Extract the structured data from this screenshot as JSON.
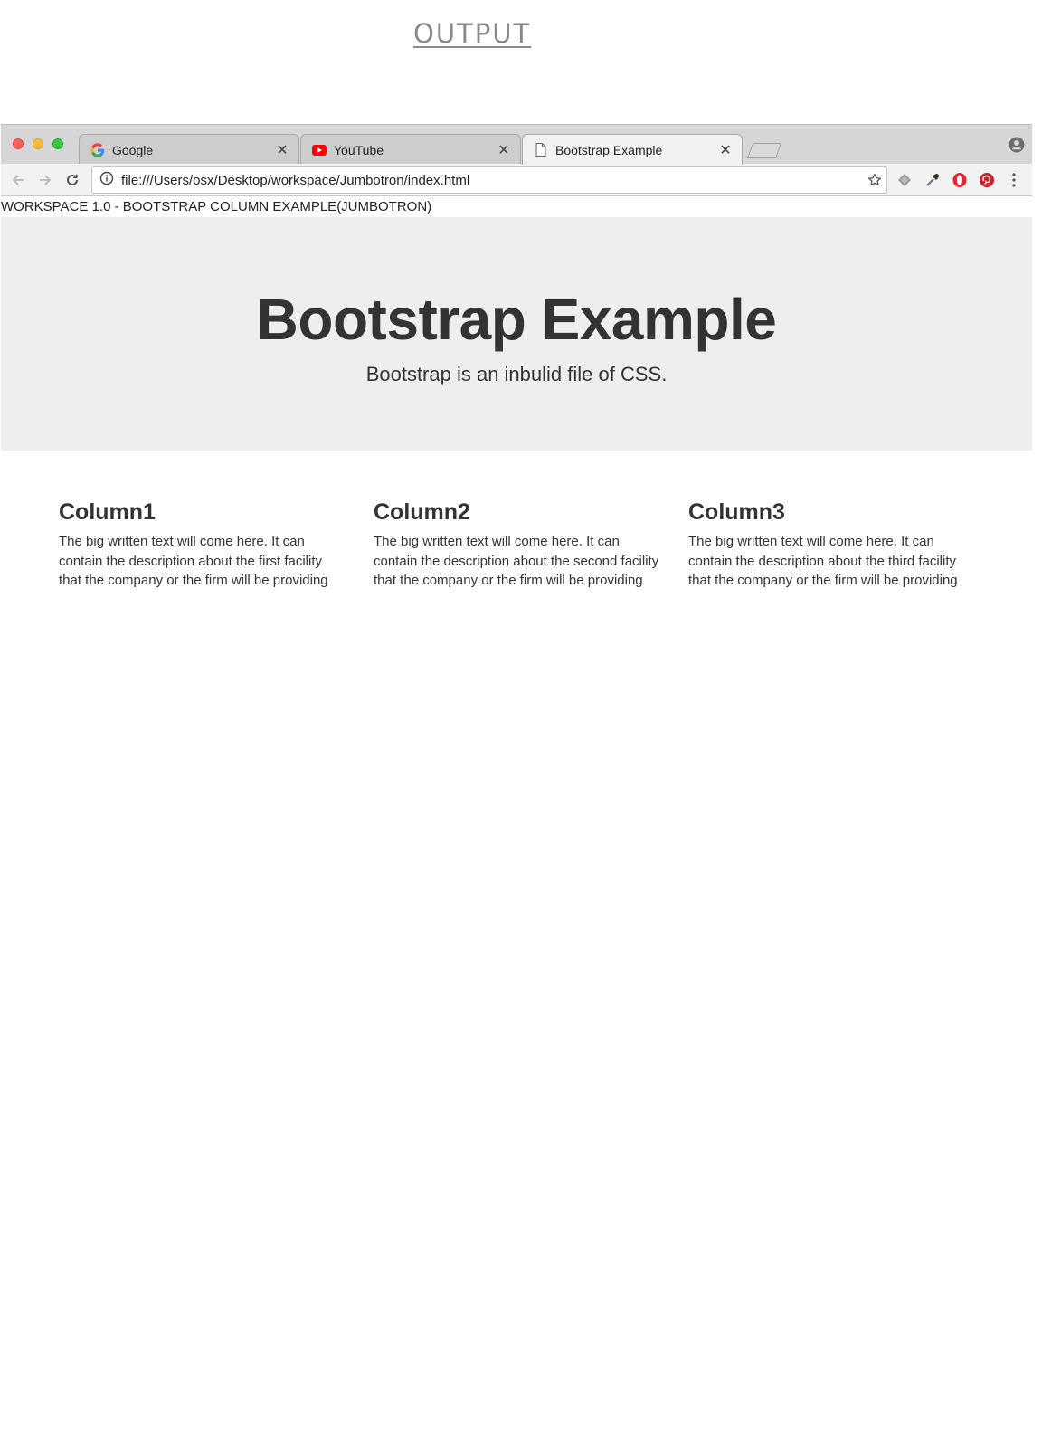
{
  "output_heading": "OUTPUT",
  "browser": {
    "tabs": [
      {
        "label": "Google",
        "icon": "google-icon",
        "active": false
      },
      {
        "label": "YouTube",
        "icon": "youtube-icon",
        "active": false
      },
      {
        "label": "Bootstrap Example",
        "icon": "page-icon",
        "active": true
      }
    ],
    "address": "file:///Users/osx/Desktop/workspace/Jumbotron/index.html"
  },
  "page": {
    "caption": "WORKSPACE 1.0 - BOOTSTRAP COLUMN EXAMPLE(JUMBOTRON)",
    "jumbotron": {
      "title": "Bootstrap Example",
      "subtitle": "Bootstrap is an inbulid file of CSS."
    },
    "columns": [
      {
        "heading": "Column1",
        "text": "The big written text will come here. It can contain the description about the first facility that the company or the firm will be providing"
      },
      {
        "heading": "Column2",
        "text": "The big written text will come here. It can contain the description about the second facility that the company or the firm will be providing"
      },
      {
        "heading": "Column3",
        "text": "The big written text will come here. It can contain the description about the third facility that the company or the firm will be providing"
      }
    ]
  },
  "colors": {
    "jumbotron_bg": "#eeeeee",
    "text": "#333333",
    "youtube_red": "#ff0000",
    "opera_red": "#e4252e",
    "pinterest_red": "#cb2027"
  }
}
